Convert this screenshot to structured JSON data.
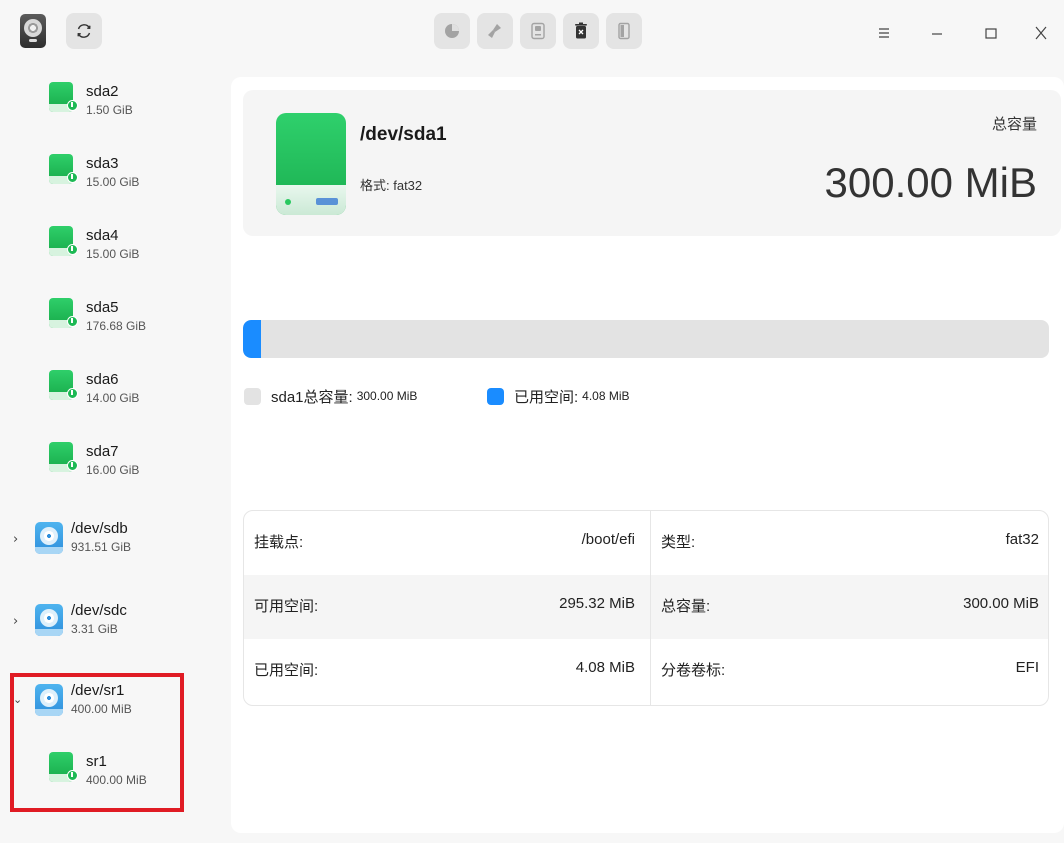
{
  "titlebar": {
    "toolbar": [
      {
        "name": "partition-icon",
        "state": "disabled"
      },
      {
        "name": "wipe-icon",
        "state": "disabled"
      },
      {
        "name": "mount-icon",
        "state": "disabled"
      },
      {
        "name": "unmount-icon",
        "state": "enabled"
      },
      {
        "name": "resize-icon",
        "state": "disabled"
      }
    ]
  },
  "sidebar": {
    "partitions": [
      {
        "name": "sda2",
        "size": "1.50 GiB"
      },
      {
        "name": "sda3",
        "size": "15.00 GiB"
      },
      {
        "name": "sda4",
        "size": "15.00 GiB"
      },
      {
        "name": "sda5",
        "size": "176.68 GiB"
      },
      {
        "name": "sda6",
        "size": "14.00 GiB"
      },
      {
        "name": "sda7",
        "size": "16.00 GiB"
      }
    ],
    "devices": [
      {
        "name": "/dev/sdb",
        "size": "931.51 GiB",
        "expanded": false
      },
      {
        "name": "/dev/sdc",
        "size": "3.31 GiB",
        "expanded": false
      },
      {
        "name": "/dev/sr1",
        "size": "400.00 MiB",
        "expanded": true
      }
    ],
    "sr1_children": [
      {
        "name": "sr1",
        "size": "400.00 MiB"
      }
    ]
  },
  "main": {
    "device": "/dev/sda1",
    "format": "格式: fat32",
    "capacity_label": "总容量",
    "capacity_value": "300.00 MiB",
    "usage_fraction": 0.0136,
    "legend": {
      "total_label": "sda1总容量:",
      "total_value": "300.00 MiB",
      "used_label": "已用空间:",
      "used_value": "4.08 MiB",
      "total_color": "#e3e3e3",
      "used_color": "#1a8cff"
    },
    "table": [
      {
        "l1": "挂载点:",
        "v1": "/boot/efi",
        "l2": "类型:",
        "v2": "fat32"
      },
      {
        "l1": "可用空间:",
        "v1": "295.32 MiB",
        "l2": "总容量:",
        "v2": "300.00 MiB"
      },
      {
        "l1": "已用空间:",
        "v1": "4.08 MiB",
        "l2": "分卷卷标:",
        "v2": "EFI"
      }
    ]
  },
  "colors": {
    "accent": "#1a8cff",
    "partition_green": "#1db954",
    "highlight_red": "#e01b24"
  }
}
